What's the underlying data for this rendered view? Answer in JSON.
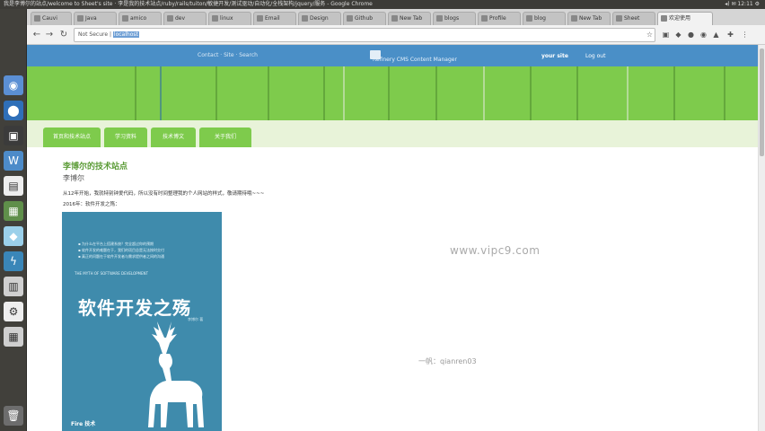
{
  "system": {
    "window_title": "我是李博尔的站点/welcome to Sheet's site · 李是我的技术站点/ruby/rails/tuiton/敏捷开发/测试驱动/自动化/全栈架构/jquery/服务 - Google Chrome",
    "tray": "◂) ✉ 12:11 ⚙"
  },
  "tabs": [
    {
      "label": "Cauvi"
    },
    {
      "label": "Java"
    },
    {
      "label": "amico"
    },
    {
      "label": "dev"
    },
    {
      "label": "linux"
    },
    {
      "label": "Email"
    },
    {
      "label": "Design"
    },
    {
      "label": "Github"
    },
    {
      "label": "New Tab"
    },
    {
      "label": "blogs"
    },
    {
      "label": "Profile"
    },
    {
      "label": "blog"
    },
    {
      "label": "New Tab"
    },
    {
      "label": "Sheet"
    },
    {
      "label": "欢迎使用"
    }
  ],
  "browser": {
    "url_prefix": "Not Secure",
    "url_selected": "localhost"
  },
  "admin": {
    "left_links": "Contact    ·    Site    ·    Search",
    "product_name": "Refinery CMS Content Manager",
    "site_link": "your site",
    "logout": "Log out"
  },
  "nav": {
    "items": [
      {
        "label": "首页和技术站点"
      },
      {
        "label": "学习资料"
      },
      {
        "label": "技术博文"
      },
      {
        "label": "关于我们"
      }
    ]
  },
  "content": {
    "site_title": "李博尔的技术站点",
    "subtitle": "李博尔",
    "intro": "从12年开始，我就特别钟爱代码，所以没有时间整理我的个人网站的样式，敬请期待哦~~~",
    "year_line": "2016年：软件开发之殇：",
    "book_line1": "▪ 为什么在平台上搭建系统？完全超过你的预期",
    "book_line2": "▪ 软件开发的难题在于，我们的项目总是无法按时交付",
    "book_line3": "▪ 真正的问题在于软件开发者与需求提供者之间的沟通",
    "book_small": "THE MYTH OF SOFTWARE DEVELOPMENT",
    "book_title": "软件开发之殇",
    "book_author": "李博尔 著",
    "book_publisher": "Fire 技术",
    "watermark_url": "www.vipc9.com",
    "watermark_user": "一帆：qianren03"
  },
  "colors": {
    "accent": "#7ecb4c",
    "admin_bar": "#4a8fc7",
    "book_cover": "#3f8bac"
  }
}
